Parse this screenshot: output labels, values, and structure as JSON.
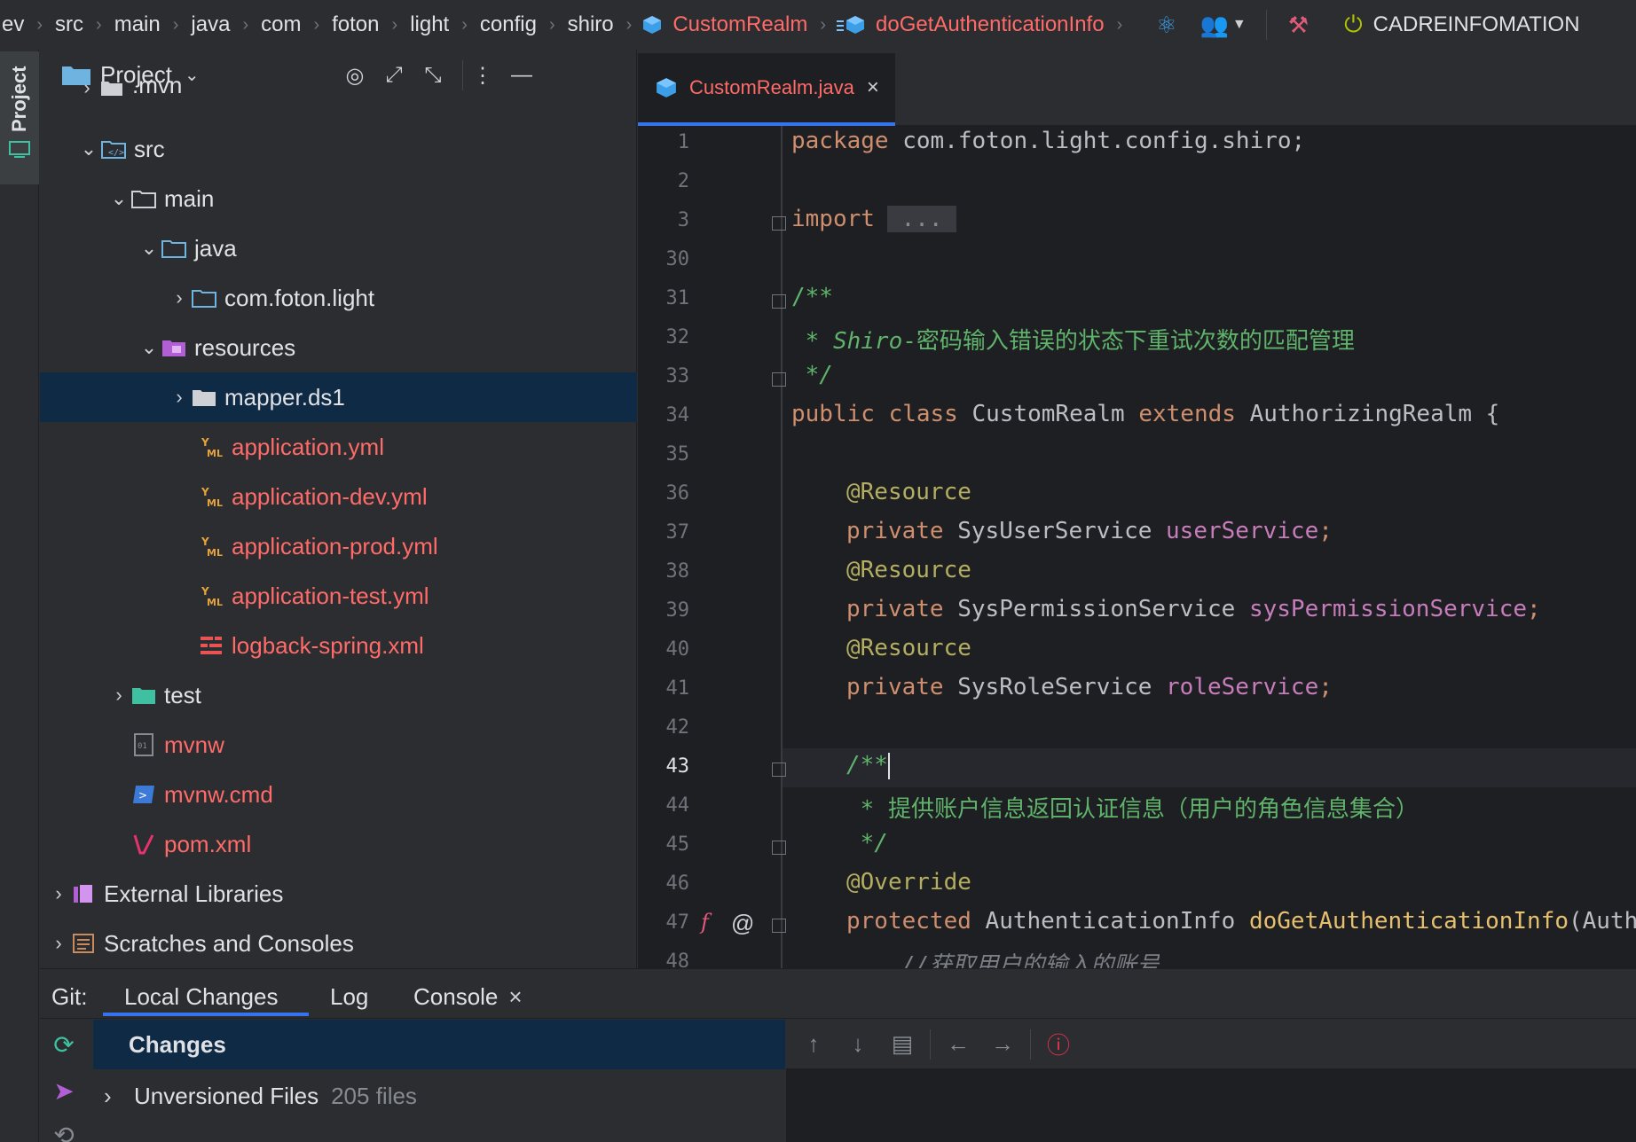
{
  "breadcrumb": {
    "items": [
      "ev",
      "src",
      "main",
      "java",
      "com",
      "foton",
      "light",
      "config",
      "shiro"
    ],
    "class_name": "CustomRealm",
    "method_name": "doGetAuthenticationInfo",
    "run_config": "CADREINFOMATION"
  },
  "tool_window_bar": {
    "project_label": "Project"
  },
  "project_panel": {
    "title": "Project",
    "tree": [
      {
        "label": ".mvn",
        "level": 1
      },
      {
        "label": "src",
        "level": 1
      },
      {
        "label": "main",
        "level": 2
      },
      {
        "label": "java",
        "level": 3
      },
      {
        "label": "com.foton.light",
        "level": 4
      },
      {
        "label": "resources",
        "level": 3
      },
      {
        "label": "mapper.ds1",
        "level": 4,
        "selected": true
      },
      {
        "label": "application.yml",
        "level": 5
      },
      {
        "label": "application-dev.yml",
        "level": 5
      },
      {
        "label": "application-prod.yml",
        "level": 5
      },
      {
        "label": "application-test.yml",
        "level": 5
      },
      {
        "label": "logback-spring.xml",
        "level": 5
      },
      {
        "label": "test",
        "level": 2
      },
      {
        "label": "mvnw",
        "level": 2
      },
      {
        "label": "mvnw.cmd",
        "level": 2
      },
      {
        "label": "pom.xml",
        "level": 2
      },
      {
        "label": "External Libraries",
        "level": 0
      },
      {
        "label": "Scratches and Consoles",
        "level": 0
      }
    ]
  },
  "editor": {
    "tab_label": "CustomRealm.java",
    "line_numbers": [
      "1",
      "2",
      "3",
      "30",
      "31",
      "32",
      "33",
      "34",
      "35",
      "36",
      "37",
      "38",
      "39",
      "40",
      "41",
      "42",
      "43",
      "44",
      "45",
      "46",
      "47",
      "48"
    ],
    "current_line": "43",
    "code": {
      "l1_kw": "package",
      "l1_rest": " com.foton.light.config.shiro;",
      "l3_kw": "import",
      "l3_fold": " ... ",
      "l31": "/**",
      "l32_star": " * ",
      "l32_italic": "Shiro",
      "l32_text": "-密码输入错误的状态下重试次数的匹配管理",
      "l33": " */",
      "l34_kw1": "public class",
      "l34_name": " CustomRealm ",
      "l34_kw2": "extends",
      "l34_rest": " AuthorizingRealm {",
      "l36": "@Resource",
      "l37_kw": "private",
      "l37_type": " SysUserService ",
      "l37_field": "userService",
      "l37_end": ";",
      "l38": "@Resource",
      "l39_kw": "private",
      "l39_type": " SysPermissionService ",
      "l39_field": "sysPermissionService",
      "l39_end": ";",
      "l40": "@Resource",
      "l41_kw": "private",
      "l41_type": " SysRoleService ",
      "l41_field": "roleService",
      "l41_end": ";",
      "l43": "/**",
      "l44_star": " * ",
      "l44_text": "提供账户信息返回认证信息（用户的角色信息集合）",
      "l45": " */",
      "l46": "@Override",
      "l47_kw": "protected",
      "l47_type": " AuthenticationInfo ",
      "l47_method": "doGetAuthenticationInfo",
      "l47_rest": "(Auth",
      "l48": "//获取用户的输入的账号"
    }
  },
  "bottom_panel": {
    "git_label": "Git:",
    "tabs": [
      "Local Changes",
      "Log",
      "Console"
    ],
    "changes_header": "Changes",
    "unversioned_label": "Unversioned Files",
    "unversioned_count": "205 files"
  },
  "colors": {
    "accent": "#3574f0",
    "selection": "#0e2a45",
    "modified_red": "#ff6b68",
    "keyword": "#cf8e6d",
    "annotation": "#b3ae60",
    "field": "#c77dbb",
    "comment": "#5fb36a"
  }
}
